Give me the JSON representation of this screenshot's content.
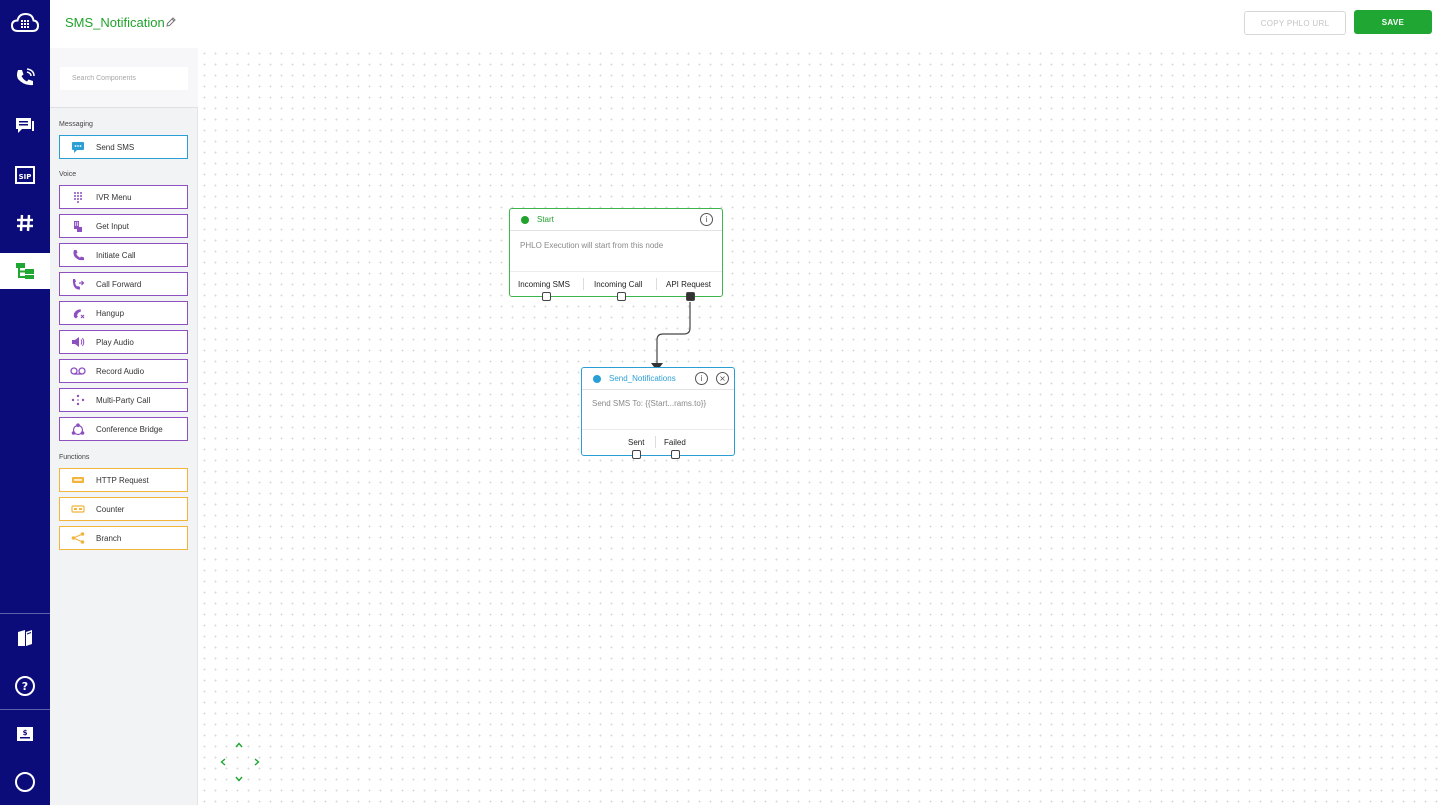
{
  "app": {
    "flow_name": "SMS_Notification",
    "copy_url_label": "COPY PHLO URL",
    "save_label": "SAVE",
    "brand_color": "#20a733"
  },
  "sidebar_nav": {
    "items": [
      {
        "icon": "cloud-logo-icon"
      },
      {
        "icon": "voice-calls-icon"
      },
      {
        "icon": "messaging-icon"
      },
      {
        "icon": "sip-icon"
      },
      {
        "icon": "numbers-icon"
      },
      {
        "icon": "phlo-flows-icon",
        "active": true
      },
      {
        "icon": "docs-book-icon"
      },
      {
        "icon": "help-icon"
      },
      {
        "icon": "account-icon"
      },
      {
        "icon": "profile-icon"
      }
    ]
  },
  "components": {
    "search_placeholder": "Search Components",
    "categories": [
      {
        "label": "Messaging",
        "items": [
          {
            "label": "Send SMS",
            "icon": "sms-bubble-icon",
            "color": "#2a9fd6"
          }
        ]
      },
      {
        "label": "Voice",
        "items": [
          {
            "label": "IVR Menu",
            "icon": "keypad-icon",
            "color": "#8e4fc0"
          },
          {
            "label": "Get Input",
            "icon": "get-input-icon",
            "color": "#8e4fc0"
          },
          {
            "label": "Initiate Call",
            "icon": "phone-icon",
            "color": "#8e4fc0"
          },
          {
            "label": "Call Forward",
            "icon": "call-forward-icon",
            "color": "#8e4fc0"
          },
          {
            "label": "Hangup",
            "icon": "hangup-icon",
            "color": "#8e4fc0"
          },
          {
            "label": "Play Audio",
            "icon": "speaker-icon",
            "color": "#8e4fc0"
          },
          {
            "label": "Record Audio",
            "icon": "voicemail-icon",
            "color": "#8e4fc0"
          },
          {
            "label": "Multi-Party Call",
            "icon": "multi-party-icon",
            "color": "#8e4fc0"
          },
          {
            "label": "Conference Bridge",
            "icon": "conference-icon",
            "color": "#8e4fc0"
          }
        ]
      },
      {
        "label": "Functions",
        "items": [
          {
            "label": "HTTP Request",
            "icon": "http-icon",
            "color": "#f3b43c"
          },
          {
            "label": "Counter",
            "icon": "counter-icon",
            "color": "#f3b43c"
          },
          {
            "label": "Branch",
            "icon": "branch-icon",
            "color": "#f3b43c"
          }
        ]
      }
    ]
  },
  "canvas": {
    "start_node": {
      "title": "Start",
      "description": "PHLO Execution will start from this node",
      "ports": [
        "Incoming SMS",
        "Incoming Call",
        "API Request"
      ],
      "color": "#3cb54a"
    },
    "sms_node": {
      "title": "Send_Notifications",
      "description": "Send SMS To: {{Start...rams.to}}",
      "ports": [
        "Sent",
        "Failed"
      ],
      "color": "#2a9fd6"
    }
  }
}
